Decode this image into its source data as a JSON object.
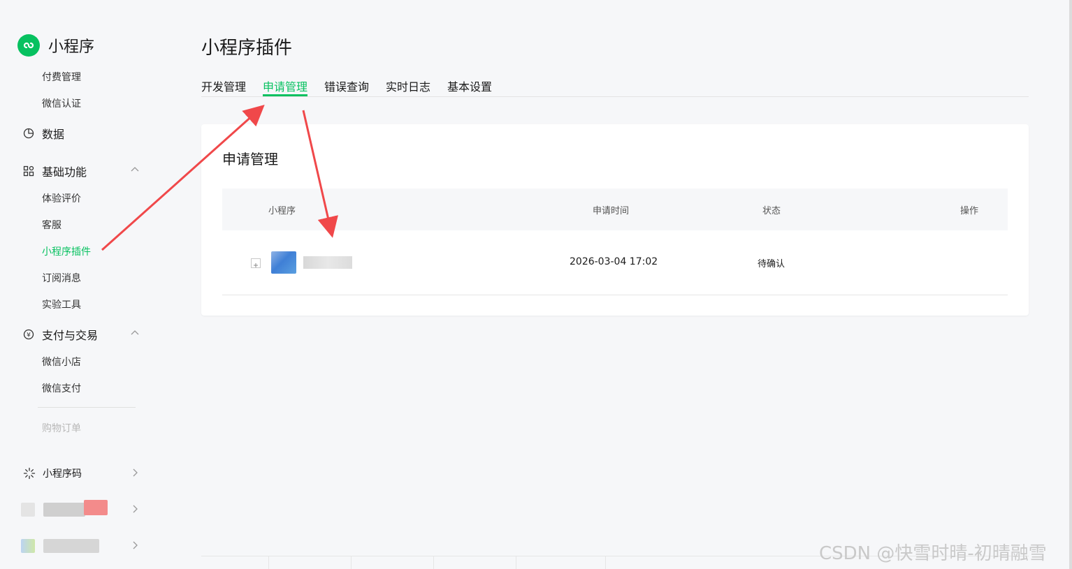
{
  "app": {
    "name": "小程序"
  },
  "sidebar": {
    "items_top": [
      {
        "label": "付费管理"
      },
      {
        "label": "微信认证"
      }
    ],
    "data_group": {
      "label": "数据",
      "icon": "pie-chart-icon"
    },
    "basic_group": {
      "label": "基础功能",
      "icon": "grid-icon",
      "items": [
        {
          "label": "体验评价"
        },
        {
          "label": "客服"
        },
        {
          "label": "小程序插件",
          "active": true
        },
        {
          "label": "订阅消息"
        },
        {
          "label": "实验工具"
        }
      ]
    },
    "pay_group": {
      "label": "支付与交易",
      "icon": "yen-icon",
      "items": [
        {
          "label": "微信小店"
        },
        {
          "label": "微信支付"
        },
        {
          "label": "购物订单",
          "disabled": true
        }
      ]
    },
    "bottom": [
      {
        "label": "小程序码",
        "icon": "qrcode-icon"
      }
    ]
  },
  "page": {
    "title": "小程序插件",
    "tabs": [
      {
        "label": "开发管理"
      },
      {
        "label": "申请管理",
        "active": true
      },
      {
        "label": "错误查询"
      },
      {
        "label": "实时日志"
      },
      {
        "label": "基本设置"
      }
    ]
  },
  "card": {
    "title": "申请管理",
    "columns": [
      "小程序",
      "申请时间",
      "状态",
      "操作"
    ],
    "rows": [
      {
        "name": "",
        "time": "2026-03-04 17:02",
        "status": "待确认",
        "action": ""
      }
    ]
  },
  "watermark": "CSDN @快雪时晴-初晴融雪",
  "colors": {
    "accent": "#07c160",
    "arrow": "#f0484a"
  }
}
